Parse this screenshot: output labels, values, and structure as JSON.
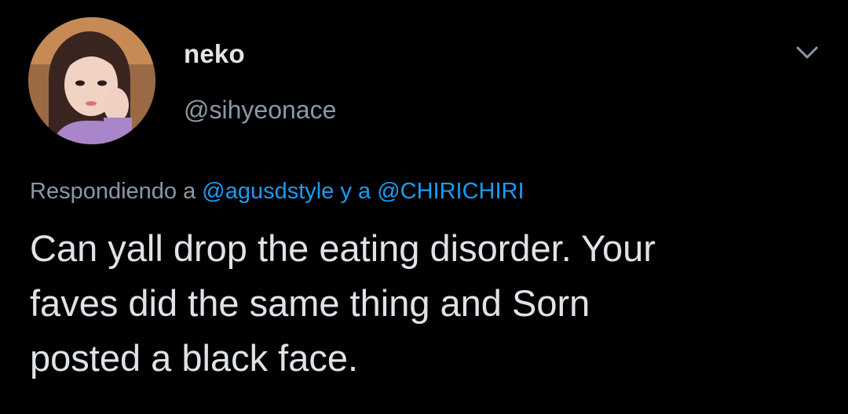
{
  "tweet": {
    "author": {
      "display_name": "neko",
      "handle": "@sihyeonace",
      "avatar_icon": "user-avatar-photo"
    },
    "menu_icon": "chevron-down-icon",
    "reply_context": {
      "prefix": "Respondiendo a",
      "mention_1": "@agusdstyle",
      "connector": "y a",
      "mention_2": "@CHIRICHIRI"
    },
    "text_lines": [
      "Can yall drop the eating disorder. Your",
      "faves did the same thing and Sorn",
      "posted a black face."
    ]
  },
  "colors": {
    "background": "#000000",
    "primary_text": "#dfe3e7",
    "secondary_text": "#8b98a5",
    "link": "#1d9bf0"
  }
}
